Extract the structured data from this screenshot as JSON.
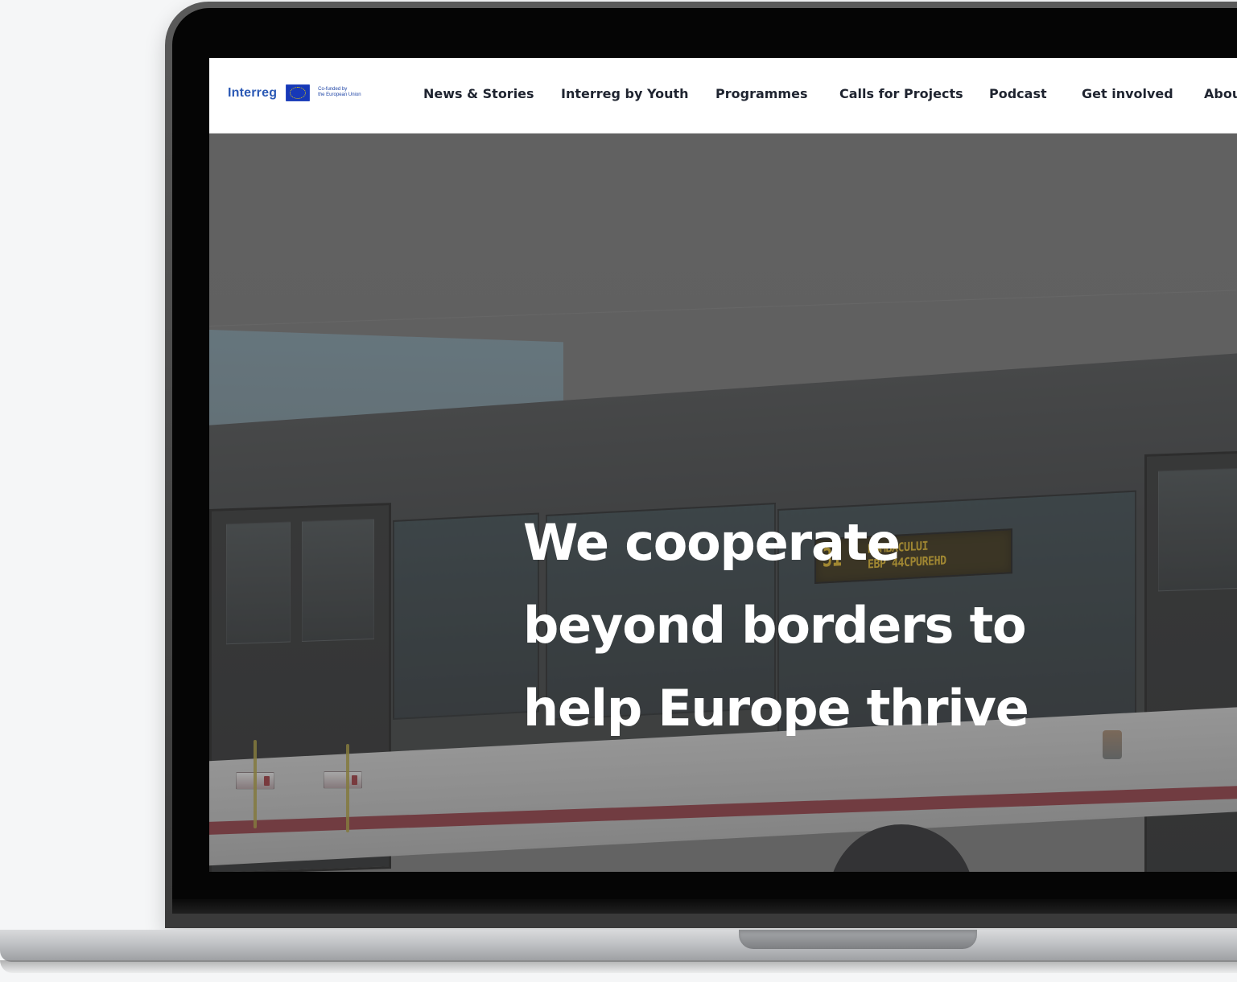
{
  "brand": {
    "name": "Interreg",
    "eu_caption_line1": "Co-funded by",
    "eu_caption_line2": "the European Union"
  },
  "nav": {
    "items": [
      "News & Stories",
      "Interreg by Youth",
      "Programmes",
      "Calls for Projects",
      "Podcast",
      "Get involved",
      "About"
    ]
  },
  "hero": {
    "title_lines": [
      "We cooperate",
      "beyond borders to",
      "help Europe thrive"
    ],
    "sign": {
      "number": "31",
      "line1": "BUMBACULUI",
      "line2": "EBP 44CPUREHD"
    }
  },
  "icons": {
    "flag": "eu-flag-icon"
  },
  "colors": {
    "brand_blue": "#2b59b5",
    "eu_blue": "#1638b8",
    "nav_text": "#1f2430",
    "hero_text": "#ffffff"
  }
}
